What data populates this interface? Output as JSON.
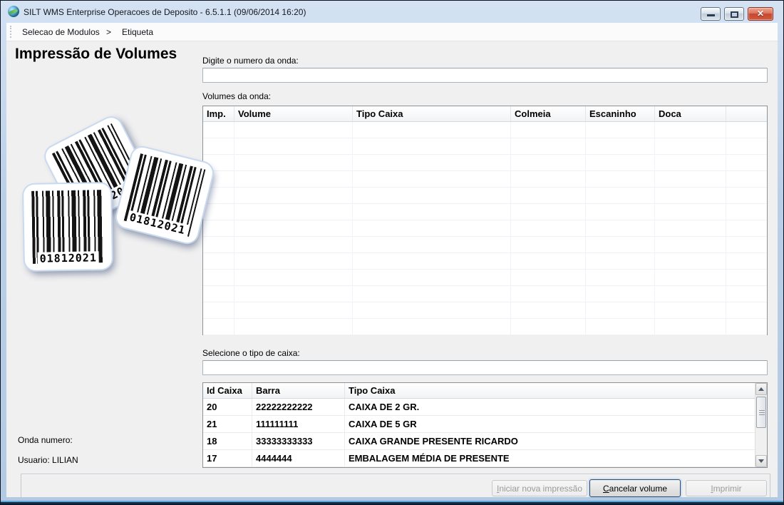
{
  "window": {
    "title": "SILT WMS Enterprise Operacoes de Deposito - 6.5.1.1 (09/06/2014 16:20)",
    "controls": {
      "minimize": "minimize",
      "maximize": "maximize",
      "close": "✕"
    }
  },
  "menubar": {
    "items": [
      "Selecao de Modulos",
      "Etiqueta"
    ],
    "separator": ">"
  },
  "left_panel": {
    "heading": "Impressão de Volumes",
    "barcode_text": "01812021",
    "onda_label": "Onda numero:",
    "usuario_label": "Usuario: LILIAN"
  },
  "wave_section": {
    "input_label": "Digite o numero da onda:",
    "input_value": "",
    "table_label": "Volumes da onda:",
    "columns": [
      "Imp.",
      "Volume",
      "Tipo Caixa",
      "Colmeia",
      "Escaninho",
      "Doca",
      ""
    ],
    "rows": [],
    "empty_row_count": 13
  },
  "box_section": {
    "input_label": "Selecione o tipo de caixa:",
    "input_value": "",
    "columns": [
      "Id Caixa",
      "Barra",
      "Tipo Caixa"
    ],
    "rows": [
      {
        "id": "20",
        "barra": "22222222222",
        "tipo": "CAIXA DE 2 GR."
      },
      {
        "id": "21",
        "barra": "111111111",
        "tipo": "CAIXA DE 5 GR"
      },
      {
        "id": "18",
        "barra": "33333333333",
        "tipo": "CAIXA GRANDE PRESENTE RICARDO"
      },
      {
        "id": "17",
        "barra": "4444444",
        "tipo": "EMBALAGEM MÉDIA DE PRESENTE"
      }
    ]
  },
  "footer": {
    "buttons": [
      {
        "label": "Iniciar nova impressão",
        "mnemonic": "I",
        "enabled": false,
        "name": "iniciar-nova-impressao-button"
      },
      {
        "label": "Cancelar volume",
        "mnemonic": "C",
        "enabled": true,
        "name": "cancelar-volume-button"
      },
      {
        "label": "Imprimir",
        "mnemonic": "I",
        "enabled": false,
        "name": "imprimir-button"
      }
    ]
  },
  "colors": {
    "titlebar_top": "#d4e2f3",
    "titlebar_bottom": "#b3cae4",
    "close_button": "#c74730",
    "content_bg": "#f0f0f0",
    "focused_button_border": "#2c4c70",
    "frame_bottom_edge": "#0e2a44"
  }
}
